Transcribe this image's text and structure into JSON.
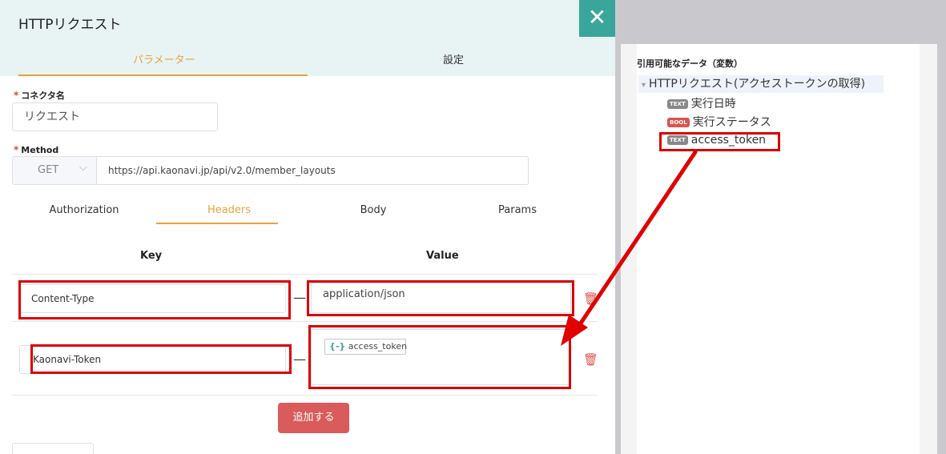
{
  "dialog": {
    "title": "HTTPリクエスト",
    "close_glyph": "✕",
    "tabs": [
      {
        "label": "パラメーター"
      },
      {
        "label": "設定"
      }
    ]
  },
  "form": {
    "connector_name": {
      "required_mark": "*",
      "label": "コネクタ名",
      "value": "リクエスト"
    },
    "method": {
      "required_mark": "*",
      "label": "Method",
      "selected": "GET",
      "chevron": "⌵",
      "url": "https://api.kaonavi.jp/api/v2.0/member_layouts"
    }
  },
  "request_tabs": [
    {
      "label": "Authorization"
    },
    {
      "label": "Headers"
    },
    {
      "label": "Body"
    },
    {
      "label": "Params"
    }
  ],
  "headers_table": {
    "key_header": "Key",
    "value_header": "Value",
    "rows": [
      {
        "key": "Content-Type",
        "dash": "—",
        "value": "application/json",
        "delete_glyph": "🗑"
      },
      {
        "key": "Kaonavi-Token",
        "dash": "—",
        "value_chip_icon": "{-}",
        "value_chip": "access_token",
        "delete_glyph": "🗑"
      }
    ]
  },
  "add_button": "追加する",
  "right_panel": {
    "title": "引用可能なデータ（変数）",
    "root": {
      "arrow": "▾",
      "label": "HTTPリクエスト(アクセストークンの取得)"
    },
    "items": [
      {
        "badge": "TEXT",
        "label": "実行日時"
      },
      {
        "badge": "BOOL",
        "label": "実行ステータス"
      },
      {
        "badge": "TEXT",
        "label": "access_token"
      }
    ]
  },
  "colors": {
    "accent": "#e8a43a",
    "close_bg": "#3aa59a",
    "add_button_bg": "#da5b5b",
    "annotation": "#d80000",
    "badge_text": "#888888",
    "badge_bool": "#d9534f"
  }
}
